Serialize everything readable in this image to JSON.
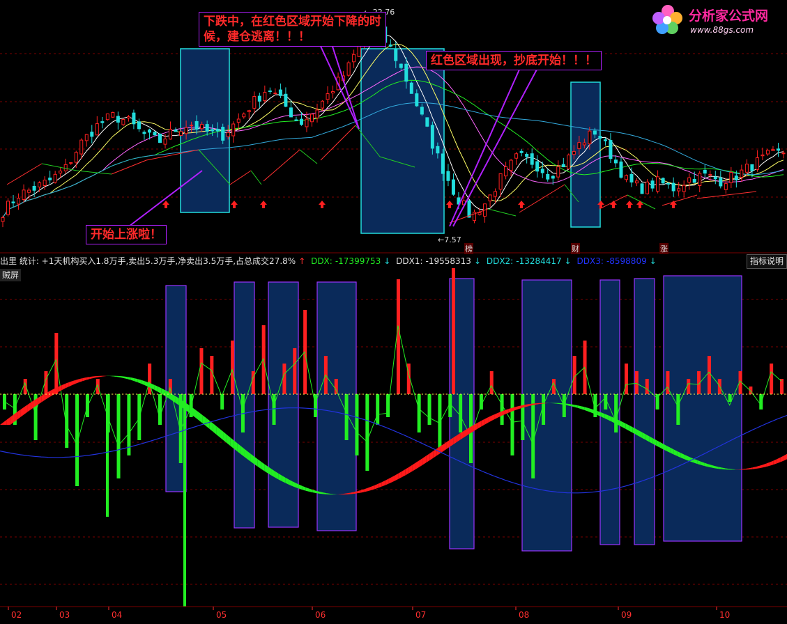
{
  "header": {
    "stats_text": "出里 统计: +1天机构买入1.8万手,卖出5.3万手,净卖出3.5万手,占总成交27.8%",
    "ddx_label": "DDX:",
    "ddx_value": "-17399753",
    "ddx1_label": "DDX1:",
    "ddx1_value": "-19558313",
    "ddx2_label": "DDX2:",
    "ddx2_value": "-13284417",
    "ddx3_label": "DDX3:",
    "ddx3_value": "-8598809",
    "indicator_button": "指标说明",
    "fullscreen_button": "贼屏"
  },
  "callouts": {
    "sell": "下跌中，在红色区域开始下降的时\n候，建仓逃离！！！",
    "buy": "红色区域出现，抄底开始！！！",
    "rise": "开始上涨啦！"
  },
  "logo": {
    "name": "分析家公式网",
    "url": "www.88gs.com"
  },
  "event_markers": [
    "榜",
    "财",
    "涨"
  ],
  "colors": {
    "up": "#ff2020",
    "down": "#22dddd",
    "vol_up": "#ff2020",
    "vol_down": "#22ee22",
    "box_fill": "#0a2a5a",
    "box_border_top": "#22dddd",
    "box_border_bottom": "#9933ff",
    "ma5": "#ffffff",
    "ma10": "#ffff66",
    "ma20": "#ff66ff",
    "ma30": "#22ee22",
    "ma60": "#33aadd"
  },
  "chart_data": [
    {
      "type": "candlestick",
      "title": "",
      "price_labels": {
        "high": "22.76",
        "low": "7.57"
      },
      "x_ticks": [
        "02",
        "03",
        "04",
        "05",
        "06",
        "07",
        "08",
        "09",
        "10"
      ],
      "ylim": [
        6,
        24
      ],
      "close_path": [
        8.2,
        9.5,
        10.0,
        10.6,
        11.5,
        13.5,
        14.8,
        15.6,
        15.2,
        14.2,
        13.6,
        14.5,
        15.0,
        14.4,
        14.0,
        15.2,
        16.6,
        17.8,
        16.5,
        15.0,
        16.0,
        17.5,
        19.0,
        21.5,
        22.2,
        20.5,
        18.0,
        15.0,
        12.0,
        9.5,
        7.8,
        9.0,
        11.0,
        12.5,
        12.0,
        11.0,
        12.0,
        13.5,
        14.5,
        12.5,
        10.5,
        10.0,
        10.5,
        10.0,
        10.8,
        11.0,
        10.6,
        11.0,
        11.8,
        12.5,
        12.8
      ],
      "highlight_ranges": [
        {
          "from": "04",
          "to": "05"
        },
        {
          "from": "06",
          "to": "07"
        },
        {
          "from": "08",
          "to": "09"
        }
      ],
      "buy_arrow_count": 11
    },
    {
      "type": "bar",
      "title": "",
      "series": [
        {
          "name": "DDX",
          "values": [
            -0.2,
            -0.4,
            0.2,
            -0.6,
            0.3,
            0.8,
            -0.7,
            -1.2,
            -0.3,
            0.2,
            -0.5,
            -1.1,
            -0.8,
            -0.6,
            0.4,
            -0.4,
            0.2,
            -0.9,
            -0.3,
            0.6,
            0.5,
            -0.2,
            0.7,
            -0.5,
            0.3,
            0.9,
            -0.4,
            0.4,
            0.6,
            1.1,
            -0.3,
            0.5,
            0.2,
            -0.6,
            -0.8,
            -1.0,
            -0.4,
            -0.3,
            1.5,
            0.4,
            -0.5,
            -0.4,
            -0.7,
            -0.3,
            -0.5,
            -0.9,
            -0.2,
            0.3,
            -0.4,
            -0.8,
            -0.6,
            -1.1,
            -0.4,
            0.2,
            -0.3,
            0.5,
            0.7,
            -0.3,
            -0.2,
            -0.5,
            0.4,
            0.3,
            0.2,
            -0.2,
            0.3,
            -0.4,
            0.2,
            0.3,
            0.5,
            0.2,
            -0.1,
            0.3,
            0.1,
            -0.2,
            0.4,
            0.2
          ]
        }
      ],
      "highlight_count": 9
    }
  ]
}
